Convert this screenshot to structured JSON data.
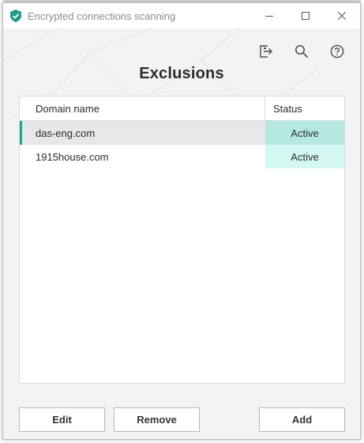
{
  "window": {
    "title": "Encrypted connections scanning",
    "controls": [
      "minimize-icon",
      "maximize-icon",
      "close-icon"
    ]
  },
  "toolbar": {
    "icons": [
      "export-icon",
      "search-icon",
      "help-icon"
    ]
  },
  "page": {
    "title": "Exclusions"
  },
  "table": {
    "columns": {
      "domain": "Domain name",
      "status": "Status"
    },
    "rows": [
      {
        "domain": "das-eng.com",
        "status": "Active",
        "selected": true
      },
      {
        "domain": "1915house.com",
        "status": "Active",
        "selected": false
      }
    ]
  },
  "buttons": {
    "edit": "Edit",
    "remove": "Remove",
    "add": "Add"
  },
  "colors": {
    "accent": "#19a88e",
    "selected_status_bg": "#b5e9e0",
    "status_bg": "#d3f8f1"
  }
}
